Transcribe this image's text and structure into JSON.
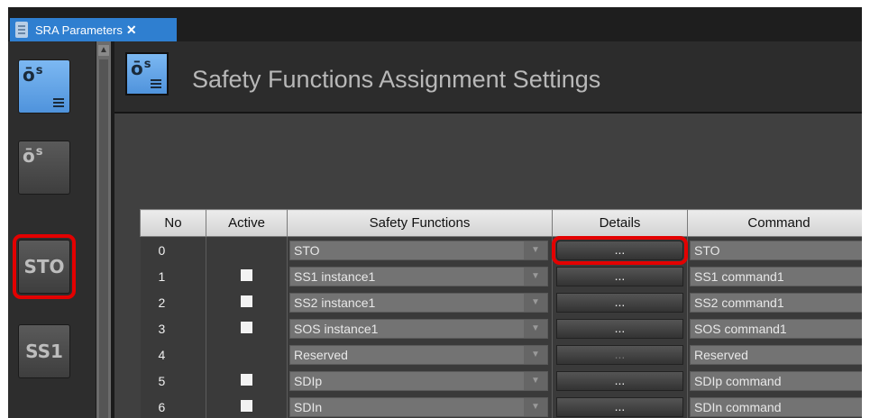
{
  "tab": {
    "label": "SRA Parameters",
    "close": "✕"
  },
  "sidebar": {
    "tools": [
      {
        "label": "",
        "icon": "safety-settings-icon"
      },
      {
        "label": "",
        "icon": "safety-wrench-icon"
      },
      {
        "label": "STO"
      },
      {
        "label": "SS1"
      }
    ]
  },
  "header": {
    "title": "Safety Functions Assignment Settings",
    "icon": "safety-settings-icon"
  },
  "table": {
    "columns": [
      "No",
      "Active",
      "Safety Functions",
      "Details",
      "Command"
    ],
    "rows": [
      {
        "no": "0",
        "active": false,
        "function": "STO",
        "details": "...",
        "command": "STO"
      },
      {
        "no": "1",
        "active": true,
        "function": "SS1 instance1",
        "details": "...",
        "command": "SS1 command1"
      },
      {
        "no": "2",
        "active": true,
        "function": "SS2 instance1",
        "details": "...",
        "command": "SS2 command1"
      },
      {
        "no": "3",
        "active": true,
        "function": "SOS instance1",
        "details": "...",
        "command": "SOS command1"
      },
      {
        "no": "4",
        "active": false,
        "function": "Reserved",
        "details": "...",
        "command": "Reserved"
      },
      {
        "no": "5",
        "active": true,
        "function": "SDIp",
        "details": "...",
        "command": "SDIp command"
      },
      {
        "no": "6",
        "active": true,
        "function": "SDIn",
        "details": "...",
        "command": "SDIn command"
      }
    ]
  },
  "colors": {
    "highlight": "#e30000",
    "accent": "#2f7fd0"
  }
}
